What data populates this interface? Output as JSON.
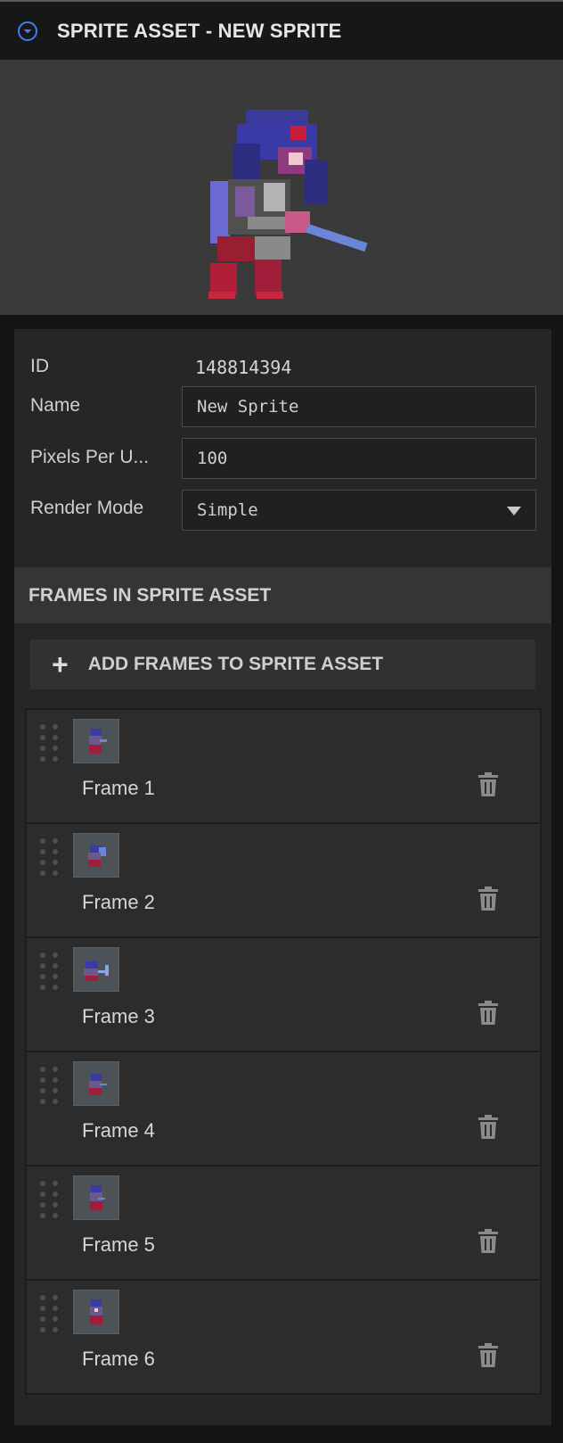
{
  "header": {
    "title": "SPRITE ASSET - NEW SPRITE",
    "collapse_icon": "chevron-down-circle-icon"
  },
  "preview": {
    "image": "pixel-art-sword-character"
  },
  "properties": {
    "id_label": "ID",
    "id_value": "148814394",
    "name_label": "Name",
    "name_value": "New Sprite",
    "ppu_label": "Pixels Per U...",
    "ppu_value": "100",
    "render_label": "Render Mode",
    "render_value": "Simple"
  },
  "frames_section": {
    "title": "FRAMES IN SPRITE ASSET",
    "add_label": "ADD FRAMES TO SPRITE ASSET",
    "frames": [
      {
        "label": "Frame 1"
      },
      {
        "label": "Frame 2"
      },
      {
        "label": "Frame 3"
      },
      {
        "label": "Frame 4"
      },
      {
        "label": "Frame 5"
      },
      {
        "label": "Frame 6"
      }
    ]
  },
  "colors": {
    "accent": "#3d7ef0",
    "background": "#141414",
    "panel": "#262626"
  }
}
